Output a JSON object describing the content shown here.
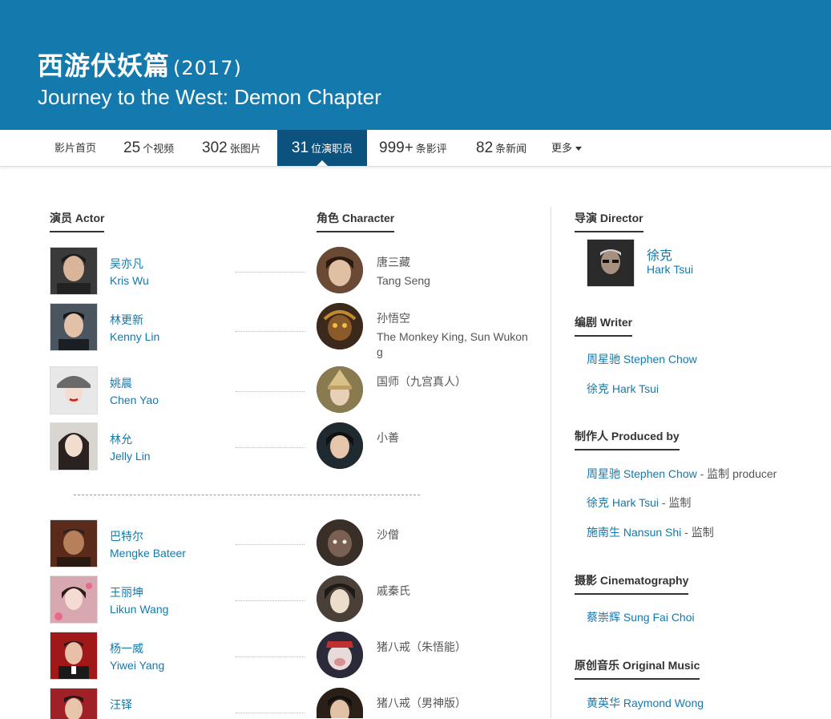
{
  "hero": {
    "title_cn": "西游伏妖篇",
    "year": "(2017)",
    "title_en": "Journey to the West: Demon Chapter"
  },
  "nav": {
    "home": "影片首页",
    "videos_num": "25",
    "videos_label": "个视频",
    "photos_num": "302",
    "photos_label": "张图片",
    "cast_num": "31",
    "cast_label": "位演职员",
    "reviews_num": "999+",
    "reviews_label": "条影评",
    "news_num": "82",
    "news_label": "条新闻",
    "more": "更多"
  },
  "headings": {
    "actor": "演员 Actor",
    "character": "角色 Character",
    "director": "导演 Director",
    "writer": "编剧 Writer",
    "producer": "制作人 Produced by",
    "cinematography": "摄影 Cinematography",
    "music": "原创音乐 Original Music"
  },
  "cast": [
    {
      "cn": "吴亦凡",
      "en": "Kris Wu",
      "role_cn": "唐三藏",
      "role_en": "Tang Seng"
    },
    {
      "cn": "林更新",
      "en": "Kenny Lin",
      "role_cn": "孙悟空",
      "role_en": "The Monkey King, Sun Wukon",
      "role_en2": "g"
    },
    {
      "cn": "姚晨",
      "en": "Chen Yao",
      "role_cn": "国师（九宫真人）",
      "role_en": ""
    },
    {
      "cn": "林允",
      "en": "Jelly Lin",
      "role_cn": "小善",
      "role_en": ""
    },
    {
      "cn": "巴特尔",
      "en": "Mengke Bateer",
      "role_cn": "沙僧",
      "role_en": ""
    },
    {
      "cn": "王丽坤",
      "en": "Likun Wang",
      "role_cn": "戚秦氏",
      "role_en": ""
    },
    {
      "cn": "杨一威",
      "en": "Yiwei Yang",
      "role_cn": "猪八戒（朱悟能）",
      "role_en": ""
    },
    {
      "cn": "汪铎",
      "en": "",
      "role_cn": "猪八戒（男神版）",
      "role_en": ""
    }
  ],
  "director": {
    "cn": "徐克",
    "en": "Hark Tsui"
  },
  "writers": [
    "周星驰 Stephen Chow",
    "徐克 Hark Tsui"
  ],
  "producers": [
    {
      "name": "周星驰 Stephen Chow",
      "role": " - 监制 producer"
    },
    {
      "name": "徐克 Hark Tsui",
      "role": " - 监制"
    },
    {
      "name": "施南生 Nansun Shi",
      "role": " - 监制"
    }
  ],
  "cinematographers": [
    "蔡崇辉 Sung Fai Choi"
  ],
  "music": [
    "黄英华 Raymond Wong"
  ],
  "colors": {
    "header_bg": "#1479ad",
    "nav_active_bg": "#0b527f",
    "link": "#1479ad"
  }
}
